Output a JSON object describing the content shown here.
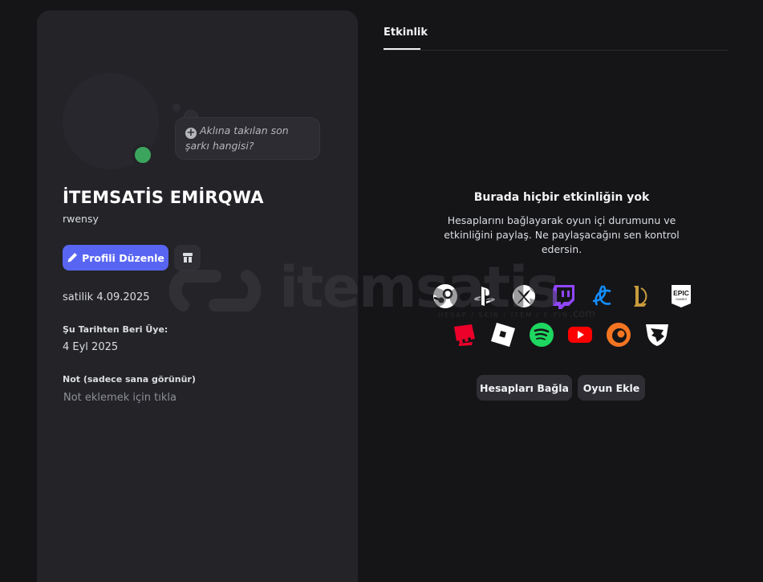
{
  "profile": {
    "status_prompt": "Aklına takılan son şarkı hangisi?",
    "display_name": "İTEMSATİS EMİRQWA",
    "username": "rwensy",
    "edit_label": "Profili Düzenle",
    "note_entry": "satilik 4.09.2025",
    "member_since_label": "Şu Tarihten Beri Üye:",
    "member_since_value": "4 Eyl 2025",
    "note_label": "Not (sadece sana görünür)",
    "note_placeholder": "Not eklemek için tıkla",
    "status_color": "#3ba55d",
    "accent_color": "#5865f2"
  },
  "activity": {
    "tab_label": "Etkinlik",
    "empty_title": "Burada hiçbir etkinliğin yok",
    "empty_desc": "Hesaplarını bağlayarak oyun içi durumunu ve etkinliğini paylaş. Ne paylaşacağını sen kontrol edersin.",
    "platforms_row1": [
      "steam-icon",
      "playstation-icon",
      "xbox-icon",
      "twitch-icon",
      "battlenet-icon",
      "league-of-legends-icon",
      "epic-games-icon"
    ],
    "platforms_row2": [
      "riot-games-icon",
      "roblox-icon",
      "spotify-icon",
      "youtube-icon",
      "crunchyroll-icon",
      "bungie-icon"
    ],
    "epic_text": "EPIC",
    "epic_sub": "GAMES",
    "connect_label": "Hesapları Bağla",
    "add_game_label": "Oyun Ekle"
  },
  "watermark": {
    "brand": "itemsatis",
    "tagline": "HESAP / SKIN / ITEM / E-PIN",
    "domain": ".com"
  }
}
